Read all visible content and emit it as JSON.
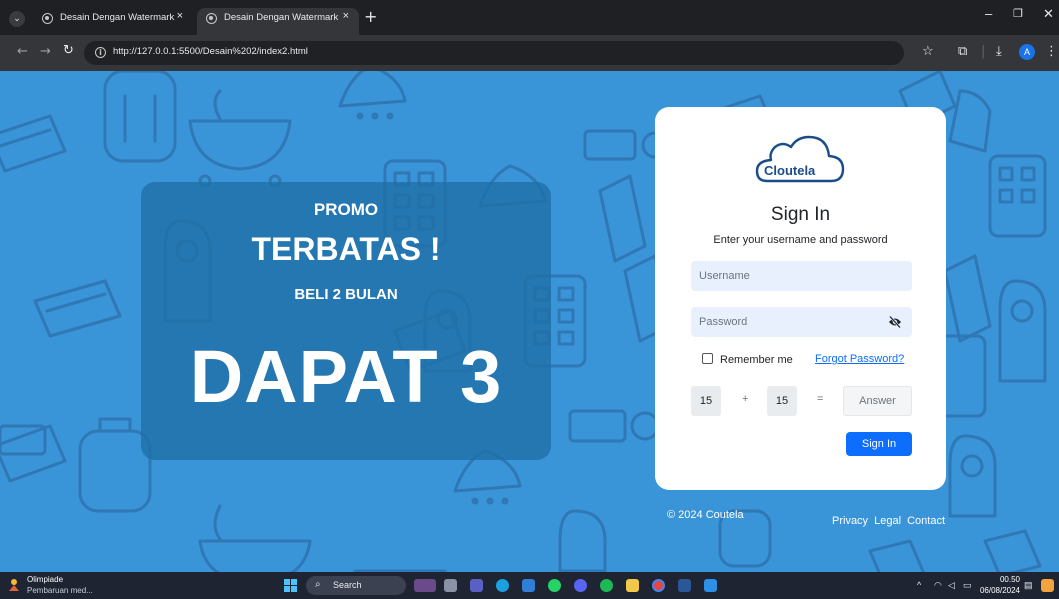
{
  "browser": {
    "tabs": [
      {
        "title": "Desain Dengan Watermark",
        "active": false
      },
      {
        "title": "Desain Dengan Watermark",
        "active": true
      }
    ],
    "url": "http://127.0.0.1:5500/Desain%202/index2.html",
    "profile_initial": "A"
  },
  "promo": {
    "line1": "PROMO",
    "line2": "TERBATAS !",
    "line3": "BELI 2 BULAN",
    "line4": "DAPAT 3"
  },
  "login": {
    "logo_text": "Cloutela",
    "title": "Sign In",
    "subtitle": "Enter your username and password",
    "username_placeholder": "Username",
    "password_placeholder": "Password",
    "remember_label": "Remember me",
    "forgot_label": "Forgot Password?",
    "captcha": {
      "a": "15",
      "op": "+",
      "b": "15",
      "eq": "=",
      "answer_placeholder": "Answer"
    },
    "submit_label": "Sign In"
  },
  "footer": {
    "copyright": "© 2024 Coutela",
    "links": [
      "Privacy",
      "Legal",
      "Contact"
    ]
  },
  "taskbar": {
    "news_title": "Olimpiade",
    "news_sub": "Pembaruan med...",
    "search_label": "Search",
    "time": "00.50",
    "date": "06/08/2024"
  },
  "colors": {
    "page_background": "#3a94d8",
    "promo_panel": "#1f6fa6",
    "primary_button": "#0d6efd",
    "input_fill": "#e8f0fe"
  }
}
